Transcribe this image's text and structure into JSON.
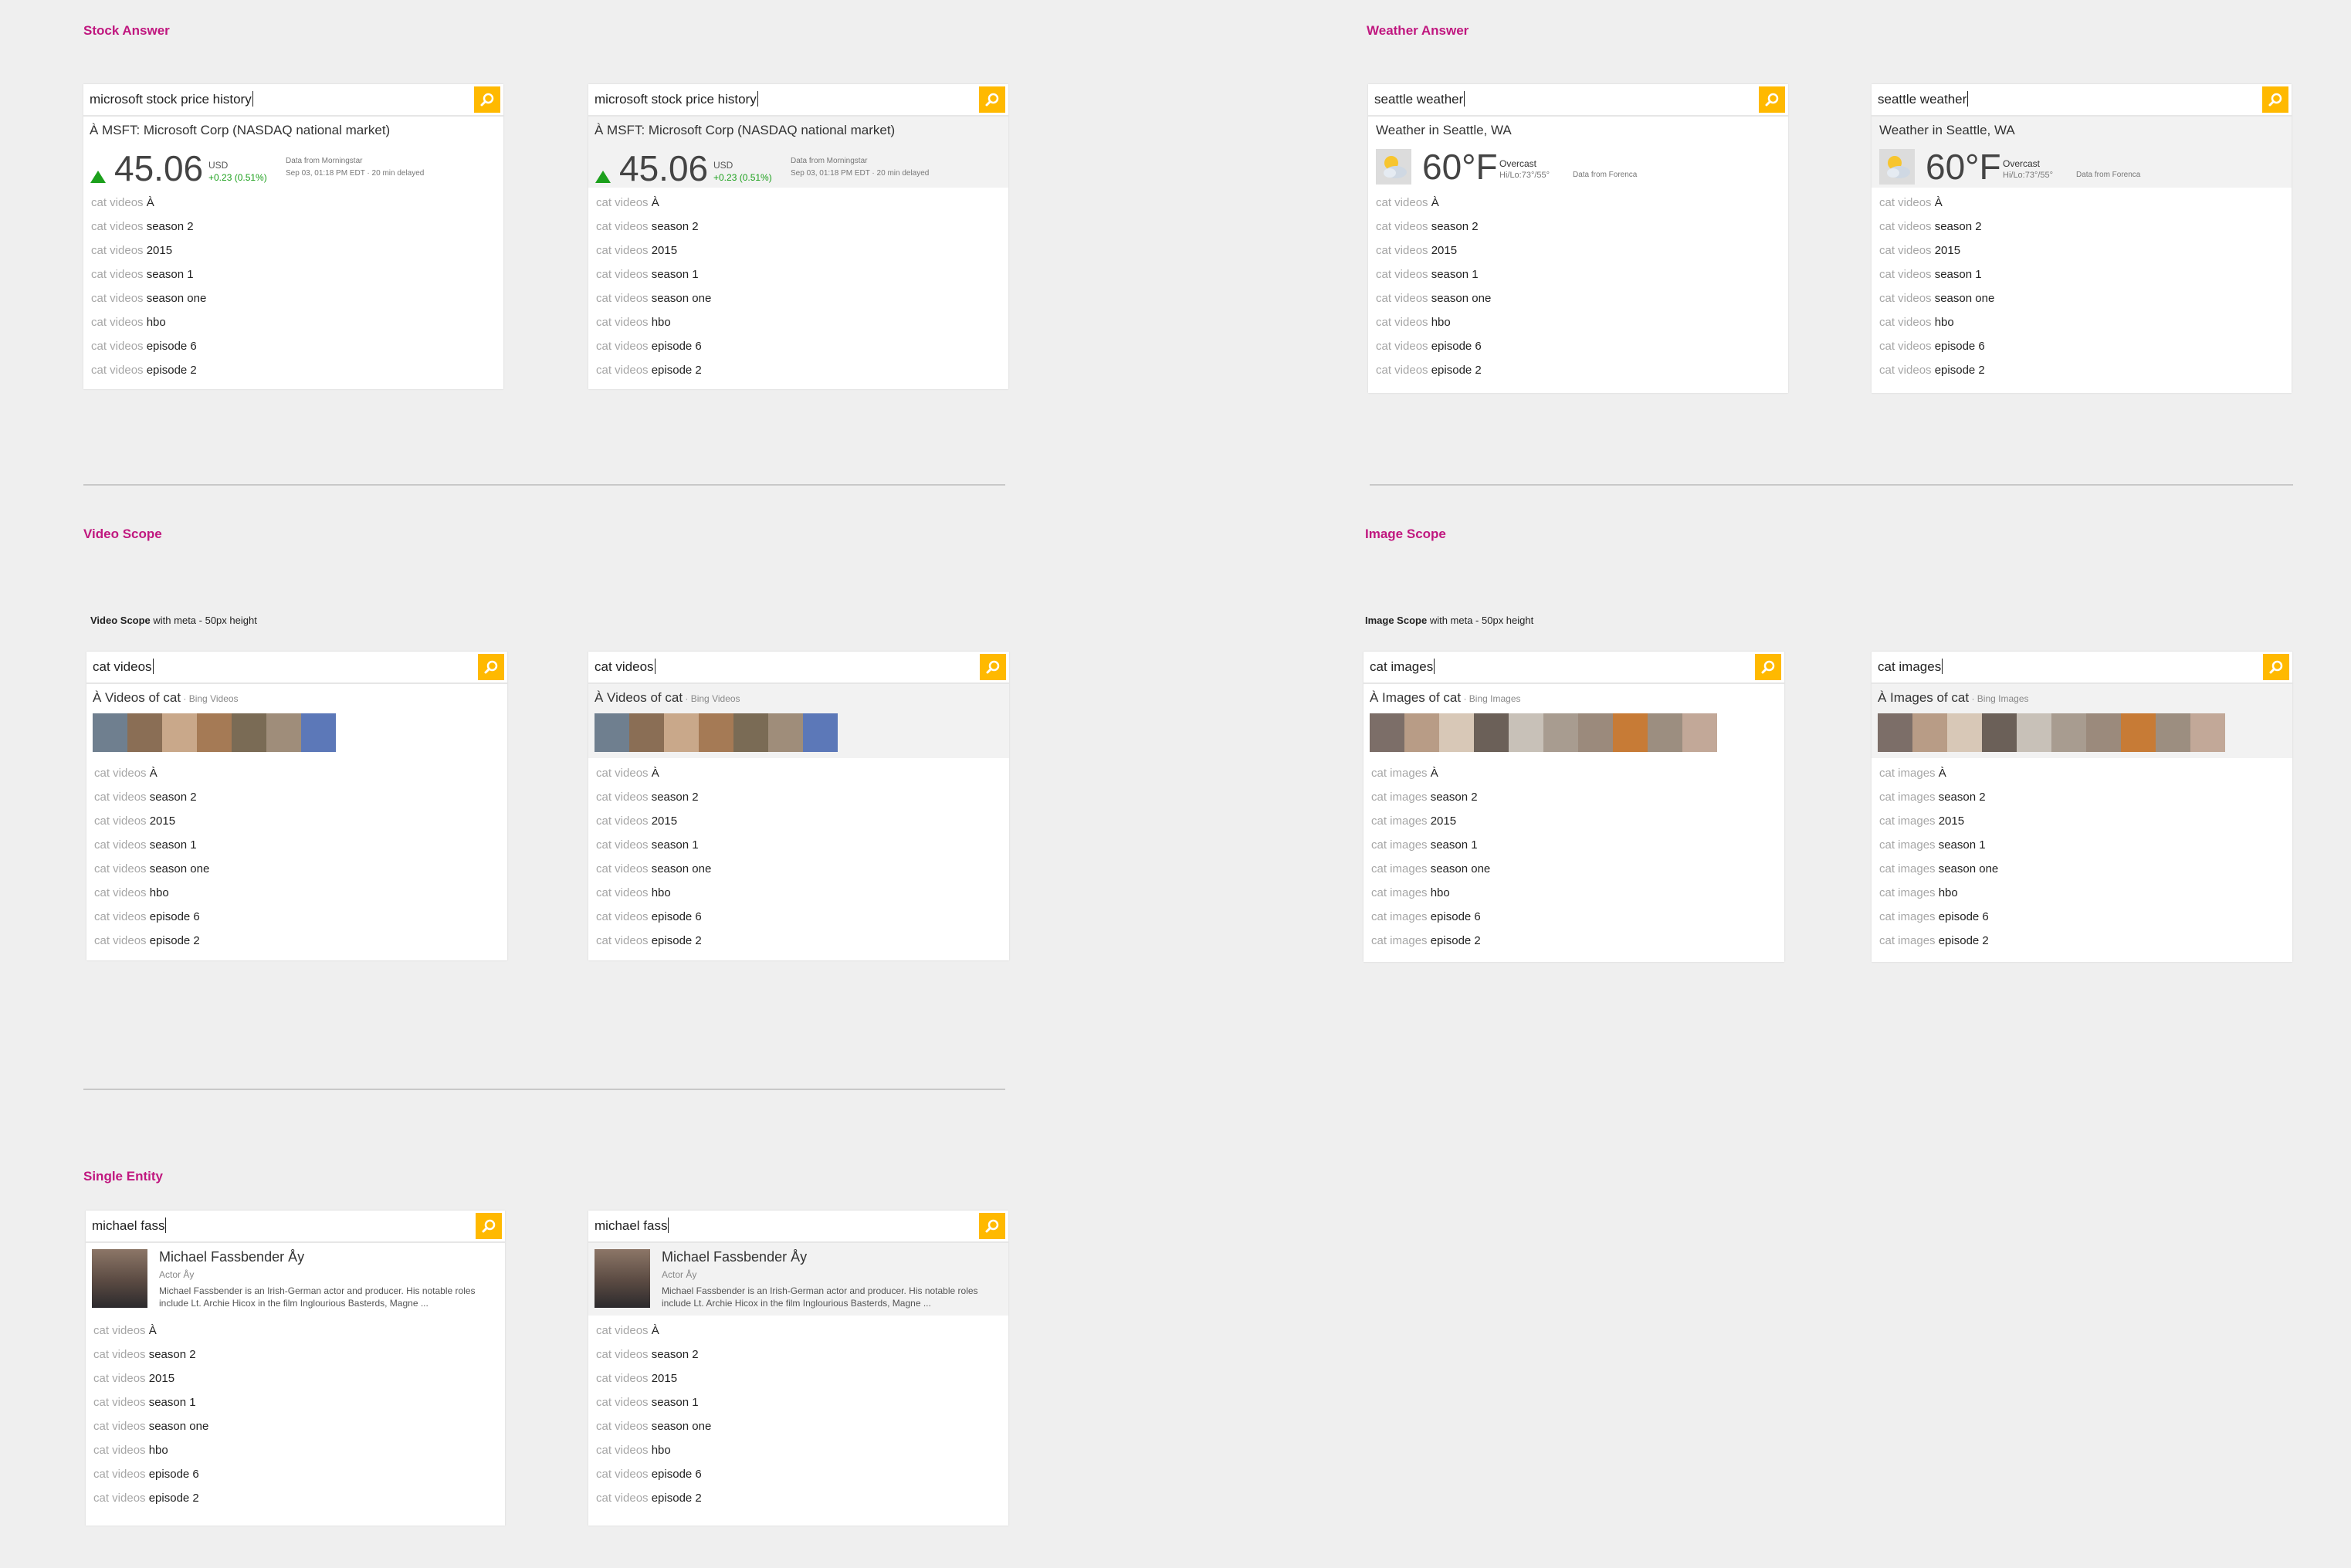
{
  "sections": {
    "stock": "Stock Answer",
    "weather": "Weather Answer",
    "video": "Video Scope",
    "image": "Image Scope",
    "entity": "Single Entity"
  },
  "subtitles": {
    "video": {
      "bold": "Video Scope",
      "rest": " with meta - 50px height"
    },
    "image": {
      "bold": "Image Scope",
      "rest": " with meta - 50px height"
    }
  },
  "stock": {
    "query": "microsoft stock price history",
    "name": "À MSFT: Microsoft Corp (NASDAQ national market)",
    "price": "45.06",
    "currency": "USD",
    "change": "+0.23 (0.51%)",
    "source": "Data from Morningstar",
    "time": "Sep 03, 01:18 PM EDT · 20 min delayed"
  },
  "weather": {
    "query": "seattle weather",
    "name": "Weather in Seattle, WA",
    "temp": "60°F",
    "condition": "Overcast",
    "hilo": "Hi/Lo:73°/55°",
    "source": "Data from Forenca",
    "icon": "partly-cloudy-icon"
  },
  "video": {
    "query": "cat videos",
    "title": "À Videos of cat",
    "source": " · Bing Videos",
    "thumb_colors": [
      "#6f7f8f",
      "#8a6e55",
      "#c9a88a",
      "#a57a55",
      "#7a6b55",
      "#9f8d7a",
      "#5c78b8"
    ]
  },
  "image": {
    "query": "cat images",
    "title": "À Images of cat",
    "source": " · Bing Images",
    "thumb_colors": [
      "#7c6e68",
      "#b89c86",
      "#d8c8b7",
      "#6b6058",
      "#c8c1b8",
      "#a89c90",
      "#9b8a7c",
      "#c77b36",
      "#9c8e80",
      "#c2a898"
    ]
  },
  "entity": {
    "query": "michael fass",
    "name": "Michael Fassbender Åy",
    "sub": "Actor Åy",
    "desc": "Michael Fassbender is an Irish-German actor and producer. His notable roles include Lt. Archie Hicox in the film Inglourious Basterds, Magne ..."
  },
  "suggestions_cat_videos": [
    {
      "pre": "cat videos ",
      "suf": " À"
    },
    {
      "pre": "cat videos ",
      "suf": "season 2"
    },
    {
      "pre": "cat videos ",
      "suf": "2015"
    },
    {
      "pre": "cat videos ",
      "suf": "season 1"
    },
    {
      "pre": "cat videos ",
      "suf": "season one"
    },
    {
      "pre": "cat videos ",
      "suf": "hbo"
    },
    {
      "pre": "cat videos ",
      "suf": "episode 6"
    },
    {
      "pre": "cat videos ",
      "suf": "episode 2"
    }
  ],
  "suggestions_cat_images": [
    {
      "pre": "cat images ",
      "suf": "À"
    },
    {
      "pre": "cat images ",
      "suf": "season 2"
    },
    {
      "pre": "cat images ",
      "suf": "2015"
    },
    {
      "pre": "cat images ",
      "suf": "season 1"
    },
    {
      "pre": "cat images ",
      "suf": "season one"
    },
    {
      "pre": "cat images ",
      "suf": "hbo"
    },
    {
      "pre": "cat images ",
      "suf": "episode 6"
    },
    {
      "pre": "cat images ",
      "suf": "episode 2"
    }
  ],
  "colors": {
    "accent": "#ffb900",
    "section_title": "#c0177f",
    "positive": "#1ca01c"
  }
}
